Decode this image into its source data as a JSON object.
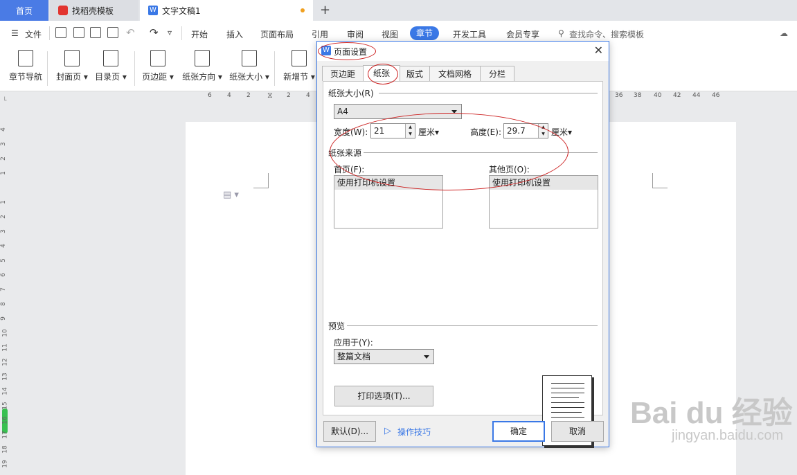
{
  "tabs": {
    "home": "首页",
    "template": "找稻壳模板",
    "document": "文字文稿1",
    "add": "+"
  },
  "menu": {
    "file": "文件",
    "items": [
      "开始",
      "插入",
      "页面布局",
      "引用",
      "审阅",
      "视图",
      "章节",
      "开发工具",
      "会员专享"
    ],
    "search": "查找命令、搜索模板"
  },
  "ribbon": {
    "items": [
      "章节导航",
      "封面页",
      "目录页",
      "页边距",
      "纸张方向",
      "纸张大小",
      "新增节"
    ]
  },
  "ruler": {
    "left_ticks": [
      "6",
      "4",
      "2",
      "",
      "2",
      "4"
    ],
    "right_ticks": [
      "36",
      "38",
      "40",
      "42",
      "44",
      "46"
    ],
    "vertical_ticks": [
      "4",
      "3",
      "2",
      "1",
      "",
      "1",
      "2",
      "3",
      "4",
      "5",
      "6",
      "7",
      "8",
      "9",
      "10",
      "11",
      "12",
      "13",
      "14",
      "15",
      "16",
      "17",
      "18",
      "19"
    ]
  },
  "dialog": {
    "title": "页面设置",
    "tabs": [
      "页边距",
      "纸张",
      "版式",
      "文档网格",
      "分栏"
    ],
    "active_tab": "纸张",
    "paper_size_label": "纸张大小(R)",
    "paper_size_value": "A4",
    "width_label": "宽度(W):",
    "width_value": "21",
    "width_unit": "厘米",
    "height_label": "高度(E):",
    "height_value": "29.7",
    "height_unit": "厘米",
    "source_label": "纸张来源",
    "first_page_label": "首页(F):",
    "first_page_value": "使用打印机设置",
    "other_pages_label": "其他页(O):",
    "other_pages_value": "使用打印机设置",
    "preview_label": "预览",
    "apply_label": "应用于(Y):",
    "apply_value": "整篇文档",
    "print_options_button": "打印选项(T)...",
    "default_button": "默认(D)...",
    "tips_link": "操作技巧",
    "ok_button": "确定",
    "cancel_button": "取消"
  },
  "watermark": {
    "main": "Bai du 经验",
    "sub": "jingyan.baidu.com"
  },
  "colors": {
    "accent": "#3a78e6",
    "annotation": "#cc1f1f"
  }
}
